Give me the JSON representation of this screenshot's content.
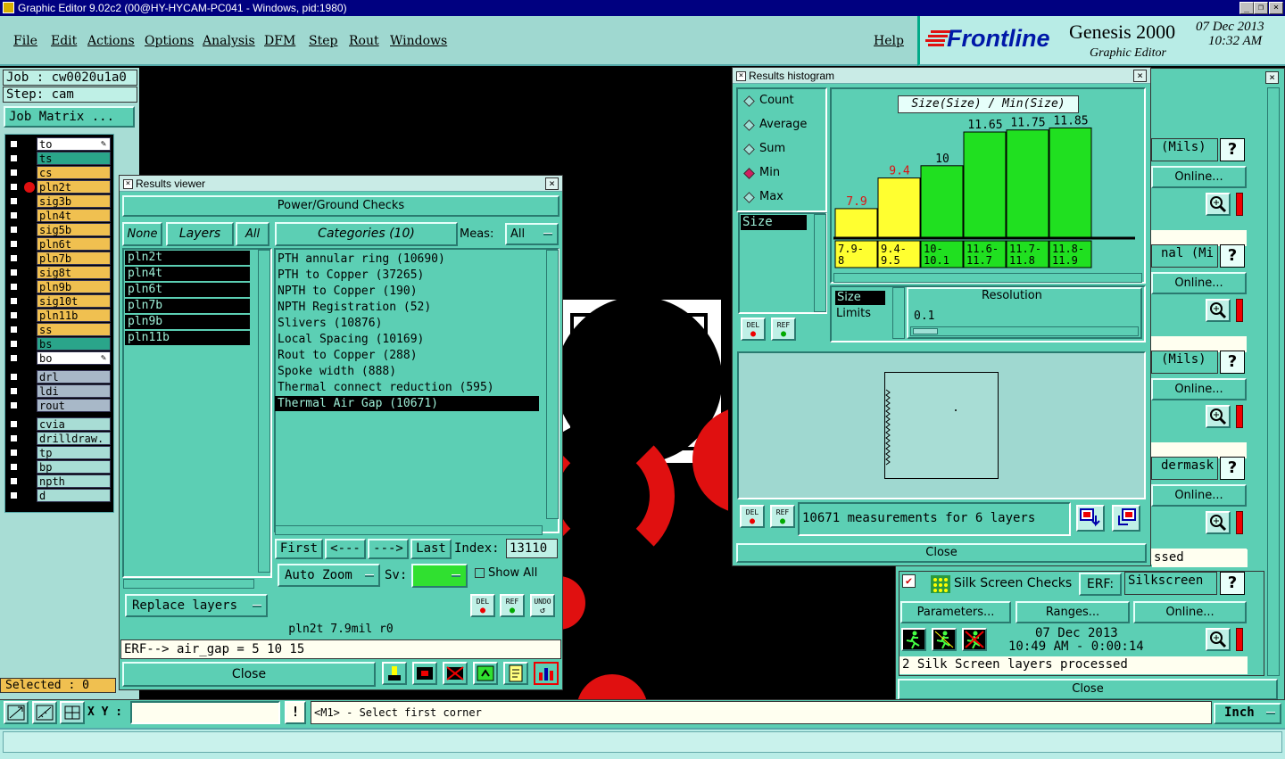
{
  "titlebar": {
    "title": "Graphic Editor 9.02c2 (00@HY-HYCAM-PC041 - Windows, pid:1980)"
  },
  "menu": {
    "file": "File",
    "edit": "Edit",
    "actions": "Actions",
    "options": "Options",
    "analysis": "Analysis",
    "dfm": "DFM",
    "step": "Step",
    "rout": "Rout",
    "windows": "Windows",
    "help": "Help"
  },
  "brand": {
    "logo": "Frontline",
    "product": "Genesis 2000",
    "subtitle": "Graphic Editor",
    "date": "07 Dec 2013",
    "time": "10:32 AM"
  },
  "job": {
    "job_label": "Job : cw0020u1a0",
    "step_label": "Step: cam",
    "matrix_btn": "Job Matrix ..."
  },
  "layers": [
    {
      "name": "to",
      "color": "#ffffff",
      "icon": true
    },
    {
      "name": "ts",
      "color": "#2aa58a"
    },
    {
      "name": "cs",
      "color": "#f0c050"
    },
    {
      "name": "pln2t",
      "color": "#f0c050",
      "active": true
    },
    {
      "name": "sig3b",
      "color": "#f0c050"
    },
    {
      "name": "pln4t",
      "color": "#f0c050"
    },
    {
      "name": "sig5b",
      "color": "#f0c050"
    },
    {
      "name": "pln6t",
      "color": "#f0c050"
    },
    {
      "name": "pln7b",
      "color": "#f0c050"
    },
    {
      "name": "sig8t",
      "color": "#f0c050"
    },
    {
      "name": "pln9b",
      "color": "#f0c050"
    },
    {
      "name": "sig10t",
      "color": "#f0c050"
    },
    {
      "name": "pln11b",
      "color": "#f0c050"
    },
    {
      "name": "ss",
      "color": "#f0c050"
    },
    {
      "name": "bs",
      "color": "#2aa58a"
    },
    {
      "name": "bo",
      "color": "#ffffff",
      "icon": true
    }
  ],
  "layers2": [
    {
      "name": "drl",
      "color": "#a8b8c8"
    },
    {
      "name": "ldi",
      "color": "#a8b8c8"
    },
    {
      "name": "rout",
      "color": "#a8b8c8"
    }
  ],
  "layers3": [
    {
      "name": "cvia",
      "color": "#a8ddd5"
    },
    {
      "name": "drilldraw.",
      "color": "#a8ddd5"
    },
    {
      "name": "tp",
      "color": "#a8ddd5"
    },
    {
      "name": "bp",
      "color": "#a8ddd5"
    },
    {
      "name": "npth",
      "color": "#a8ddd5"
    },
    {
      "name": "d",
      "color": "#a8ddd5"
    }
  ],
  "selected": "Selected : 0",
  "statusbar": {
    "xy_label": "X Y :",
    "prompt": "<M1> - Select first corner",
    "units": "Inch"
  },
  "results_viewer": {
    "title": "Results viewer",
    "header": "Power/Ground Checks",
    "none": "None",
    "layers": "Layers",
    "all": "All",
    "categories_btn": "Categories (10)",
    "meas_label": "Meas:",
    "meas_value": "All",
    "layer_list": [
      "pln2t",
      "pln4t",
      "pln6t",
      "pln7b",
      "pln9b",
      "pln11b"
    ],
    "categories": [
      "PTH annular ring (10690)",
      "PTH to Copper (37265)",
      "NPTH to Copper (190)",
      "NPTH Registration (52)",
      "Slivers (10876)",
      "Local Spacing (10169)",
      "Rout to Copper (288)",
      "Spoke width (888)",
      "Thermal connect reduction (595)",
      "Thermal Air Gap (10671)"
    ],
    "selected_category": 9,
    "first": "First",
    "prev": "<---",
    "next": "--->",
    "last": "Last",
    "index_label": "Index:",
    "index_value": "13110",
    "auto_zoom": "Auto Zoom",
    "sv_label": "Sv:",
    "show_all": "Show All",
    "replace_layers": "Replace layers",
    "del": "DEL",
    "ref": "REF",
    "undo": "UNDO",
    "info": "pln2t 7.9mil  r0",
    "erf": "ERF--> air_gap = 5 10 15",
    "close": "Close"
  },
  "histogram": {
    "title": "Results histogram",
    "options": [
      "Count",
      "Average",
      "Sum",
      "Min",
      "Max"
    ],
    "selected_option": "Min",
    "field": "Size",
    "chart_title": "Size(Size) / Min(Size)",
    "limits_label1": "Size",
    "limits_label2": "Limits",
    "resolution_label": "Resolution",
    "resolution_value": "0.1",
    "measurements": "10671 measurements for 6 layers",
    "del": "DEL",
    "ref": "REF",
    "close": "Close"
  },
  "chart_data": {
    "type": "bar",
    "title": "Size(Size) / Min(Size)",
    "categories": [
      "7.9-8",
      "9.4-9.5",
      "10-10.1",
      "11.6-11.7",
      "11.7-11.8",
      "11.8-11.9"
    ],
    "bin_labels": [
      [
        "7.9-",
        "8"
      ],
      [
        "9.4-",
        "9.5"
      ],
      [
        "10-",
        "10.1"
      ],
      [
        "11.6-",
        "11.7"
      ],
      [
        "11.7-",
        "11.8"
      ],
      [
        "11.8-",
        "11.9"
      ]
    ],
    "values": [
      7.9,
      9.4,
      10,
      11.65,
      11.75,
      11.85
    ],
    "value_labels": [
      "7.9",
      "9.4",
      "10",
      "11.65",
      "11.75",
      "11.85"
    ],
    "ylim": [
      6.5,
      12
    ],
    "colors": [
      "#ffff30",
      "#ffff30",
      "#20e020",
      "#20e020",
      "#20e020",
      "#20e020"
    ]
  },
  "checklist": {
    "rows": [
      {
        "label": "(Mils)",
        "online": "Online..."
      },
      {
        "label": "nal (Mi",
        "online": "Online..."
      },
      {
        "label": "(Mils)",
        "online": "Online..."
      },
      {
        "label": "dermask",
        "online": "Online..."
      }
    ],
    "status_partial": "ssed",
    "silk_title": "Silk Screen Checks",
    "erf_label": "ERF:",
    "erf_value": "Silkscreen",
    "parameters": "Parameters...",
    "ranges": "Ranges...",
    "online": "Online...",
    "date": "07 Dec 2013",
    "time": "10:49 AM - 0:00:14",
    "status": "2 Silk Screen layers processed",
    "close": "Close",
    "q": "?"
  }
}
